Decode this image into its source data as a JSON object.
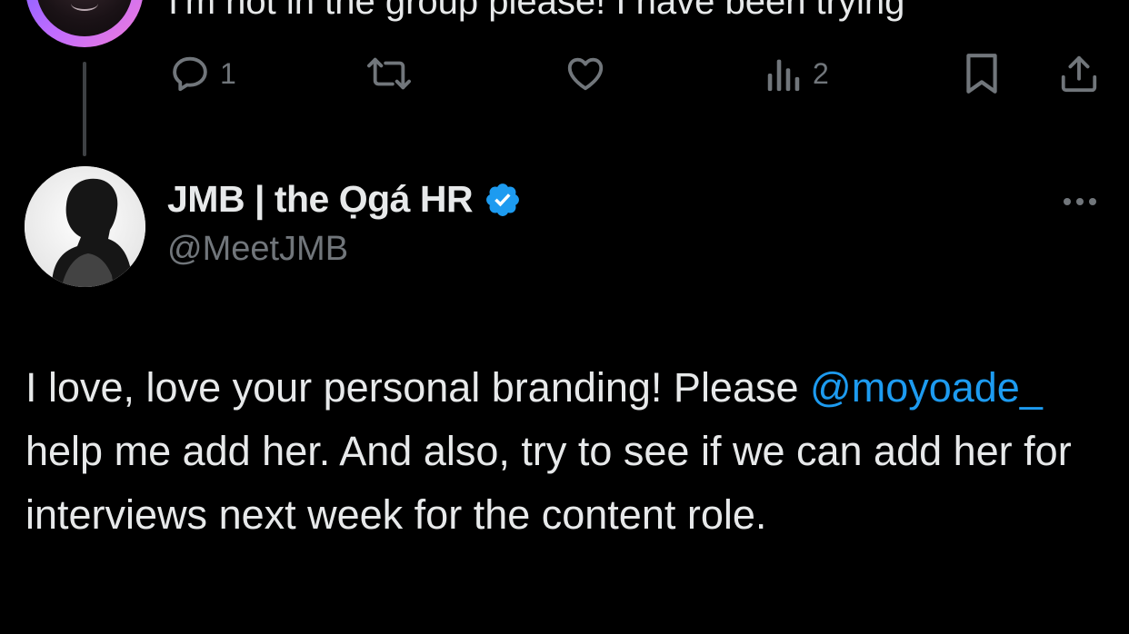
{
  "previous_tweet": {
    "text": "I'm not in the group please! I have been trying",
    "reply_count": "1",
    "view_count": "2"
  },
  "tweet": {
    "display_name": "JMB | the Ọgá HR",
    "handle": "@MeetJMB",
    "verified": true,
    "body_before_mention": "I love, love your personal branding! Please ",
    "mention": "@moyoade_",
    "body_after_mention": " help me add her. And also, try to see if we can add her for interviews next week for the content role."
  },
  "icons": {
    "reply": "reply-icon",
    "retweet": "retweet-icon",
    "like": "heart-icon",
    "views": "views-icon",
    "bookmark": "bookmark-icon",
    "share": "share-icon",
    "verified": "verified-badge-icon",
    "more": "more-options-icon"
  },
  "colors": {
    "background": "#000000",
    "text_primary": "#e7e9ea",
    "text_secondary": "#71767b",
    "accent": "#1d9bf0",
    "verified_badge": "#1d9bf0",
    "thread_line": "#3e4144"
  }
}
